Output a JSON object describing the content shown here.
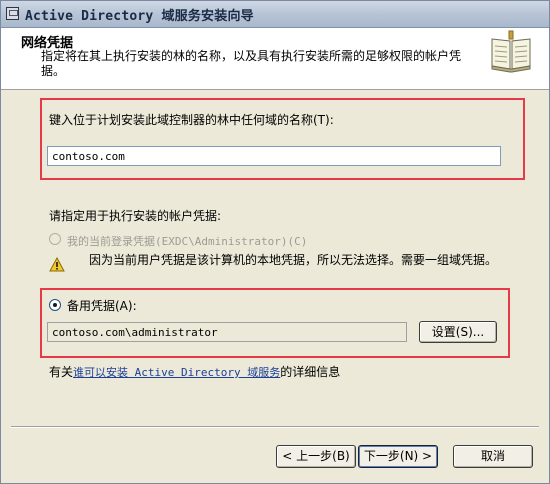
{
  "window": {
    "title": "Active Directory 域服务安装向导"
  },
  "header": {
    "title": "网络凭据",
    "description": "指定将在其上执行安装的林的名称，以及具有执行安装所需的足够权限的帐户凭据。"
  },
  "domain_section": {
    "label": "键入位于计划安装此域控制器的林中任何域的名称(T):",
    "value": "contoso.com"
  },
  "credentials": {
    "label": "请指定用于执行安装的帐户凭据:",
    "current_option": "我的当前登录凭据(EXDC\\Administrator)(C)",
    "warning_text": "因为当前用户凭据是该计算机的本地凭据，所以无法选择。需要一组域凭据。",
    "alternate_option": "备用凭据(A):",
    "alternate_value": "contoso.com\\administrator",
    "set_button": "设置(S)..."
  },
  "info": {
    "prefix": "有关",
    "link": "谁可以安装 Active Directory 域服务",
    "suffix": "的详细信息"
  },
  "footer": {
    "back": "< 上一步(B)",
    "next": "下一步(N) >",
    "cancel": "取消"
  },
  "colors": {
    "highlight_border": "#e63a49",
    "link": "#1a3f9a",
    "dialog_bg": "#ece9d8"
  },
  "icons": {
    "app": "window-app-icon",
    "header": "book-icon",
    "warning": "warning-icon"
  }
}
